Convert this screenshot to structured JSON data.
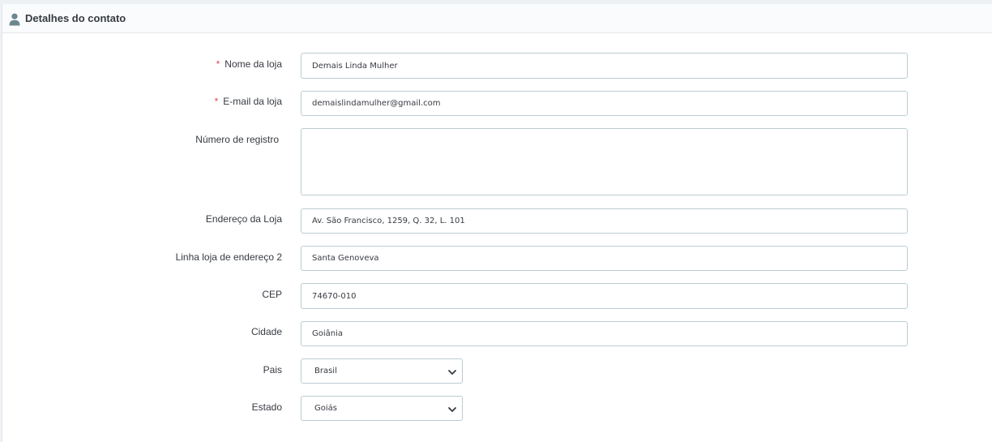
{
  "section": {
    "title": "Detalhes do contato",
    "icon": "user-icon"
  },
  "form": {
    "required_marker": "*",
    "shop_name": {
      "label": "Nome da loja",
      "value": "Demais Linda Mulher",
      "required": true
    },
    "shop_email": {
      "label": "E-mail da loja",
      "value": "demaislindamulher@gmail.com",
      "required": true
    },
    "registration_number": {
      "label": "Número de registro",
      "value": ""
    },
    "address1": {
      "label": "Endereço da Loja",
      "value": "Av. São Francisco, 1259, Q. 32, L. 101"
    },
    "address2": {
      "label": "Linha loja de endereço 2",
      "value": "Santa Genoveva"
    },
    "postcode": {
      "label": "CEP",
      "value": "74670-010"
    },
    "city": {
      "label": "Cidade",
      "value": "Goiânia"
    },
    "country": {
      "label": "Pais",
      "value": "Brasil"
    },
    "state": {
      "label": "Estado",
      "value": "Goiás"
    }
  },
  "colors": {
    "required": "#e9425b",
    "border": "#bbcdd2",
    "text": "#363a41"
  }
}
